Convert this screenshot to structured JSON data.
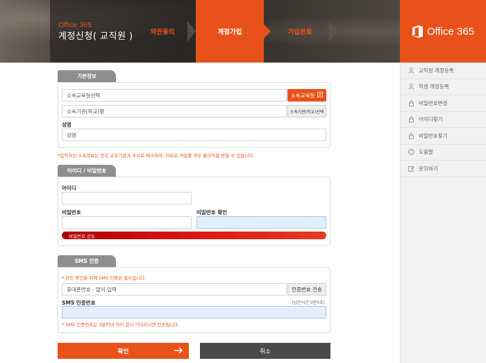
{
  "header": {
    "brand_small": "Office 365",
    "title": "계정신청( 교직원 )",
    "steps": [
      "약관동의",
      "계정가입",
      "가입완료"
    ],
    "active_step": 2,
    "logo_text": "Office 365",
    "accent_color": "#e8521a"
  },
  "sidebar": {
    "items": [
      {
        "label": "교직원 계정등록",
        "icon": "person-icon"
      },
      {
        "label": "학생 계정등록",
        "icon": "person-icon"
      },
      {
        "label": "비밀번호변경",
        "icon": "lock-icon"
      },
      {
        "label": "아이디찾기",
        "icon": "lock-icon"
      },
      {
        "label": "비밀번호찾기",
        "icon": "lock-icon"
      },
      {
        "label": "도움말",
        "icon": "help-icon"
      },
      {
        "label": "문의하기",
        "icon": "edit-icon"
      }
    ]
  },
  "basic_info": {
    "tab": "기본정보",
    "edu_office_placeholder": "소속교육청선택",
    "edu_office_button": "소속교육청",
    "institution_placeholder": "소속기관(학교)명",
    "institution_button": "소속기관(학교)선택",
    "name_label": "성명",
    "name_placeholder": "성명",
    "note": "*입력하신 소속정보는 전국 교육기관과 수시로 체크하며, 허위로 가입할 경우 불이익을 받을 수 있습니다."
  },
  "id_password": {
    "tab": "아이디 / 비밀번호",
    "id_label": "아이디",
    "id_value": "",
    "password_label": "비밀번호",
    "password_confirm_label": "비밀번호 확인",
    "strength_label": "비밀번호 강도"
  },
  "sms": {
    "tab": "SMS 인증",
    "notice": "* 본인 확인을 위해 SMS 인증은 필수입니다.",
    "phone_placeholder": "휴대폰번호 - 없이 입력",
    "send_button": "인증번호 전송",
    "code_label": "SMS 인증번호",
    "remaining_time": "(남은시간 0분0초)",
    "footer_note": "* SMS 인증번호는 3분이내 까지 감시 기다리시면 전송됩니다."
  },
  "actions": {
    "confirm": "확인",
    "cancel": "취소"
  }
}
